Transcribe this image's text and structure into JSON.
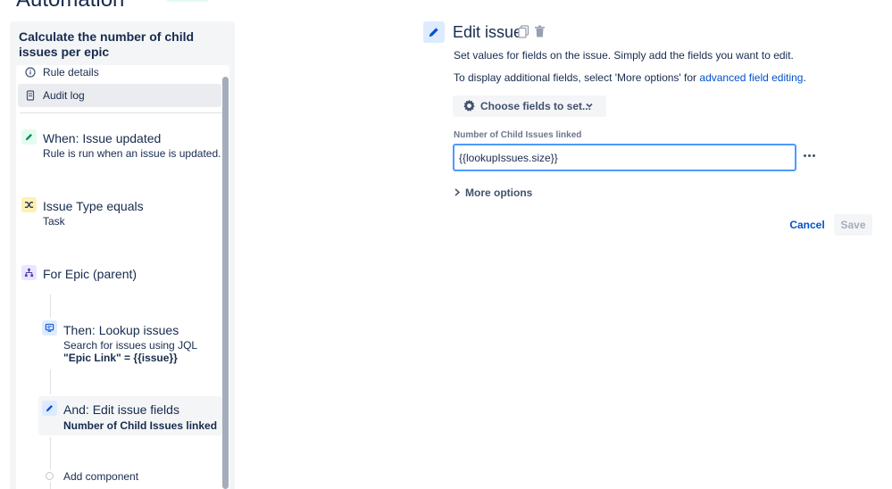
{
  "header": {
    "title": "Automation"
  },
  "sidebar": {
    "rule_name": "Calculate the number of child issues per epic",
    "menu": [
      {
        "label": "Rule details",
        "icon": "info-icon"
      },
      {
        "label": "Audit log",
        "icon": "document-icon"
      }
    ],
    "components": {
      "trigger": {
        "title": "When: Issue updated",
        "subtitle": "Rule is run when an issue is updated.",
        "icon": "pencil-icon"
      },
      "condition": {
        "title": "Issue Type equals",
        "subtitle": "Task",
        "icon": "condition-icon"
      },
      "branch": {
        "title": "For Epic (parent)",
        "icon": "branch-icon"
      },
      "lookup": {
        "title": "Then: Lookup issues",
        "subtitle": "Search for issues using JQL",
        "detail": "\"Epic Link\" = {{issue}}",
        "icon": "lookup-icon"
      },
      "edit": {
        "title": "And: Edit issue fields",
        "detail": "Number of Child Issues linked",
        "icon": "pencil-icon"
      },
      "add": {
        "label": "Add component"
      }
    }
  },
  "editor": {
    "title": "Edit issue",
    "description": "Set values for fields on the issue. Simply add the fields you want to edit.",
    "additional_prefix": "To display additional fields, select 'More options' for ",
    "additional_link": "advanced field editing",
    "additional_suffix": ".",
    "choose_fields_label": "Choose fields to set...",
    "field_label": "Number of Child Issues linked",
    "field_value": "{{lookupIssues.size}}",
    "more_options_label": "More options",
    "cancel_label": "Cancel",
    "save_label": "Save"
  },
  "colors": {
    "accent": "#0052cc",
    "focus_border": "#4c9aff",
    "trigger_icon_bg": "#e3fcef",
    "condition_icon_bg": "#fff0b3",
    "branch_icon_bg": "#eae6ff",
    "action_icon_bg": "#deebff"
  }
}
